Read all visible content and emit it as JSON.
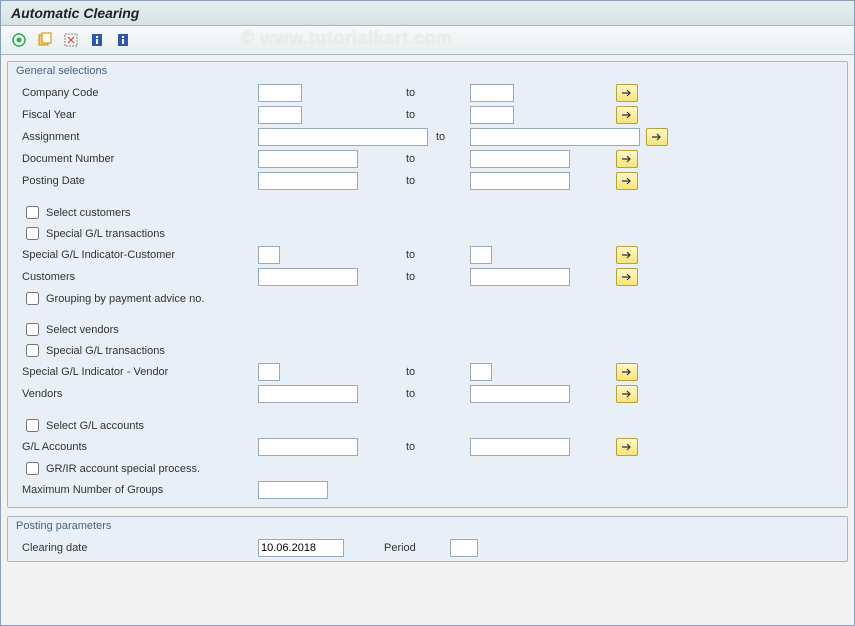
{
  "title": "Automatic Clearing",
  "watermark": "© www.tutorialkart.com",
  "toolbar": {
    "execute": "Execute",
    "variants": "Get Variant",
    "program": "Program",
    "docs1": "Help",
    "docs2": "Info"
  },
  "labels": {
    "to": "to"
  },
  "group1": {
    "title": "General selections",
    "company_code": "Company Code",
    "fiscal_year": "Fiscal Year",
    "assignment": "Assignment",
    "doc_number": "Document Number",
    "posting_date": "Posting Date"
  },
  "customers": {
    "select": "Select customers",
    "special_gl": "Special G/L transactions",
    "indicator": "Special G/L Indicator-Customer",
    "customers": "Customers",
    "grouping": "Grouping by payment advice no."
  },
  "vendors": {
    "select": "Select vendors",
    "special_gl": "Special G/L transactions",
    "indicator": "Special G/L Indicator - Vendor",
    "vendors": "Vendors"
  },
  "gl": {
    "select": "Select G/L accounts",
    "accounts": "G/L Accounts",
    "grir": "GR/IR account special process.",
    "max_groups": "Maximum Number of Groups"
  },
  "group2": {
    "title": "Posting parameters",
    "clearing_date": "Clearing date",
    "clearing_date_value": "10.06.2018",
    "period": "Period"
  }
}
